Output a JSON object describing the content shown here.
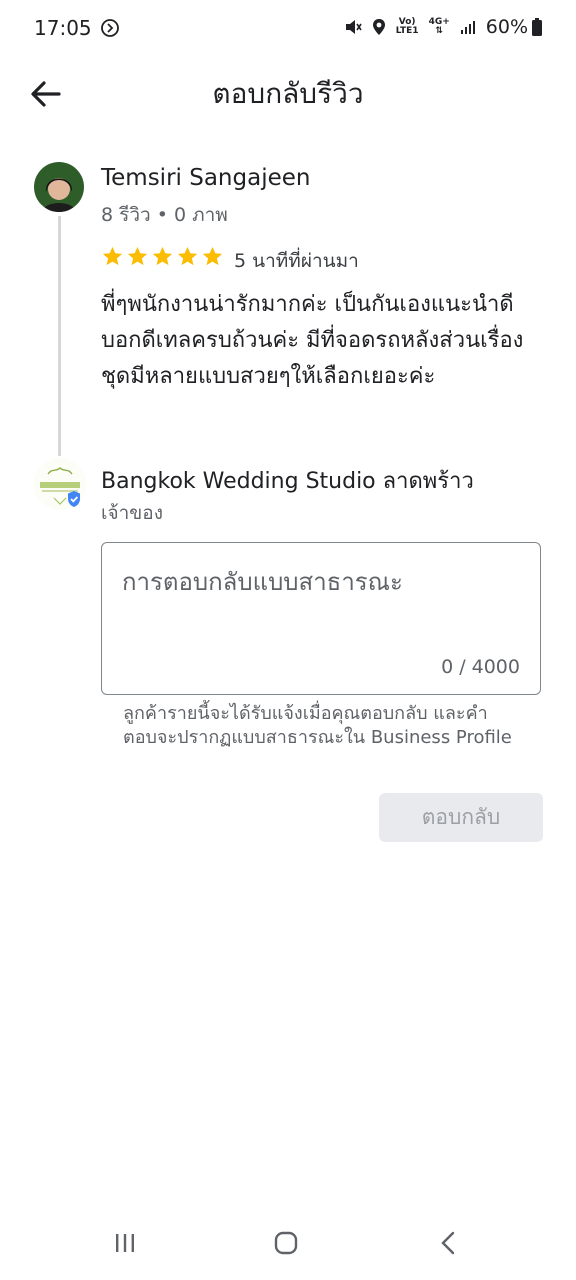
{
  "status_bar": {
    "time": "17:05",
    "battery": "60%",
    "network_top": "Vo)",
    "network_bottom": "LTE1",
    "data_type": "4G+",
    "icons": [
      "cast-icon",
      "mute-icon",
      "location-icon",
      "signal-icon",
      "battery-icon"
    ]
  },
  "header": {
    "title": "ตอบกลับรีวิว",
    "back_icon": "arrow-left-icon"
  },
  "review": {
    "reviewer_name": "Temsiri Sangajeen",
    "reviewer_meta": "8 รีวิว • 0 ภาพ",
    "rating": 5,
    "rating_max": 5,
    "time_ago": "5 นาทีที่ผ่านมา",
    "text": "พี่ๆพนักงานน่ารักมากค่ะ เป็นกันเองแนะนำดี บอกดีเทลครบถ้วนค่ะ มีที่จอดรถหลังส่วนเรื่องชุดมีหลายแบบสวยๆให้เลือกเยอะค่ะ"
  },
  "owner": {
    "business_name": "Bangkok Wedding Studio",
    "branch": "ลาดพร้าว",
    "role": "เจ้าของ"
  },
  "reply": {
    "placeholder": "การตอบกลับแบบสาธารณะ",
    "counter": "0 / 4000",
    "hint": "ลูกค้ารายนี้จะได้รับแจ้งเมื่อคุณตอบกลับ และคำตอบจะปรากฏแบบสาธารณะใน Business Profile",
    "submit_label": "ตอบกลับ"
  },
  "colors": {
    "star": "#fbbc04",
    "verified": "#4285f4",
    "disabled_button_bg": "#e8eaed",
    "disabled_button_text": "#9aa0a6"
  },
  "nav_bar": {
    "icons": [
      "recent-apps-icon",
      "home-icon",
      "back-icon"
    ]
  }
}
